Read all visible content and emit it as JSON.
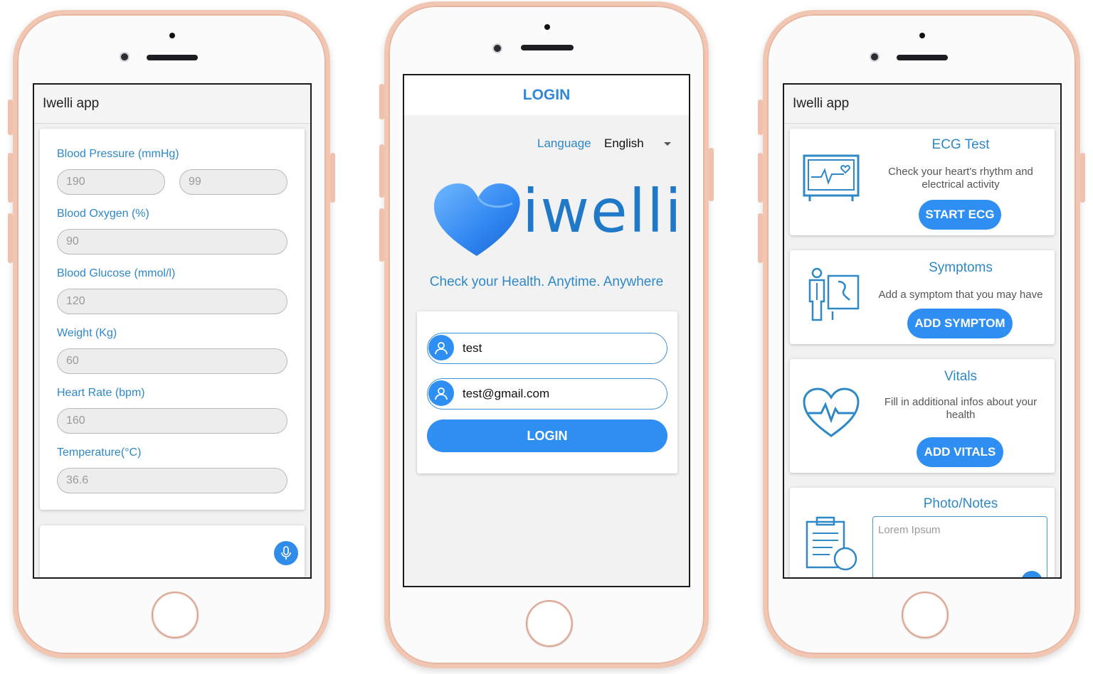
{
  "colors": {
    "accent": "#2f8ef1",
    "label_blue": "#2f88c6",
    "phone_frame": "#f1c6b2"
  },
  "left_screen": {
    "app_title": "Iwelli app",
    "fields": [
      {
        "label": "Blood Pressure (mmHg)",
        "values": [
          "190",
          "99"
        ]
      },
      {
        "label": "Blood Oxygen (%)",
        "value": "90"
      },
      {
        "label": "Blood Glucose (mmol/l)",
        "value": "120"
      },
      {
        "label": "Weight (Kg)",
        "value": "60"
      },
      {
        "label": "Heart Rate (bpm)",
        "value": "160"
      },
      {
        "label": "Temperature(°C)",
        "value": "36.6"
      }
    ],
    "mic_icon": "microphone-icon"
  },
  "center_screen": {
    "title": "LOGIN",
    "language_label": "Language",
    "language_value": "English",
    "logo_text": "iwelli",
    "tagline": "Check your Health. Anytime. Anywhere",
    "username": "test",
    "email": "test@gmail.com",
    "login_button": "LOGIN"
  },
  "right_screen": {
    "app_title": "Iwelli app",
    "cards": [
      {
        "title": "ECG Test",
        "desc": "Check your heart's rhythm and electrical activity",
        "button": "START ECG",
        "icon": "ecg-monitor-icon"
      },
      {
        "title": "Symptoms",
        "desc": "Add a symptom that you may have",
        "button": "ADD SYMPTOM",
        "icon": "patient-diagnosis-icon"
      },
      {
        "title": "Vitals",
        "desc": "Fill in additional infos about your health",
        "button": "ADD VITALS",
        "icon": "heartbeat-icon"
      },
      {
        "title": "Photo/Notes",
        "notes_placeholder": "Lorem Ipsum",
        "icon": "clipboard-icon"
      }
    ]
  }
}
